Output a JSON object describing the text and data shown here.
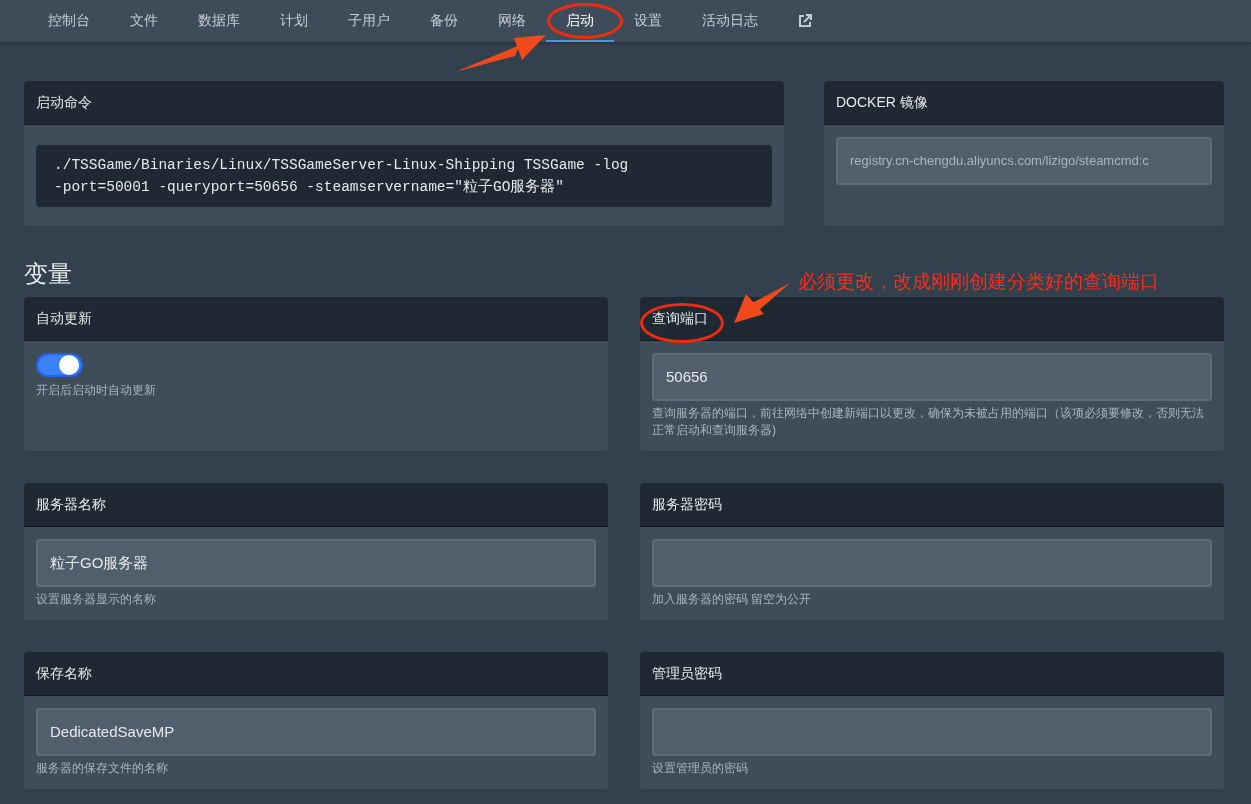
{
  "nav": {
    "tabs": [
      {
        "label": "控制台",
        "selected": false
      },
      {
        "label": "文件",
        "selected": false
      },
      {
        "label": "数据库",
        "selected": false
      },
      {
        "label": "计划",
        "selected": false
      },
      {
        "label": "子用户",
        "selected": false
      },
      {
        "label": "备份",
        "selected": false
      },
      {
        "label": "网络",
        "selected": false
      },
      {
        "label": "启动",
        "selected": true
      },
      {
        "label": "设置",
        "selected": false
      },
      {
        "label": "活动日志",
        "selected": false
      }
    ]
  },
  "startup_command": {
    "title": "启动命令",
    "lines": [
      "./TSSGame/Binaries/Linux/TSSGameServer-Linux-Shipping TSSGame -log",
      "-port=50001 -queryport=50656 -steamservername=\"粒子GO服务器\""
    ]
  },
  "docker_image": {
    "title": "DOCKER 镜像",
    "value": "registry.cn-chengdu.aliyuncs.com/lizigo/steamcmd:c"
  },
  "variables_heading": "变量",
  "variables": [
    {
      "kind": "toggle",
      "label": "自动更新",
      "on": true,
      "description": "开启后启动时自动更新"
    },
    {
      "kind": "text",
      "label": "查询端口",
      "value": "50656",
      "description": "查询服务器的端口，前往网络中创建新端口以更改，确保为未被占用的端口（该项必须要修改，否则无法正常启动和查询服务器)"
    },
    {
      "kind": "text",
      "label": "服务器名称",
      "value": "粒子GO服务器",
      "description": "设置服务器显示的名称"
    },
    {
      "kind": "text",
      "label": "服务器密码",
      "description": "加入服务器的密码 留空为公开"
    },
    {
      "kind": "text",
      "label": "保存名称",
      "value": "DedicatedSaveMP",
      "description": "服务器的保存文件的名称"
    },
    {
      "kind": "text",
      "label": "管理员密码",
      "description": "设置管理员的密码"
    }
  ],
  "annotation": {
    "note": "必须更改，改成刚刚创建分类好的查询端口"
  }
}
